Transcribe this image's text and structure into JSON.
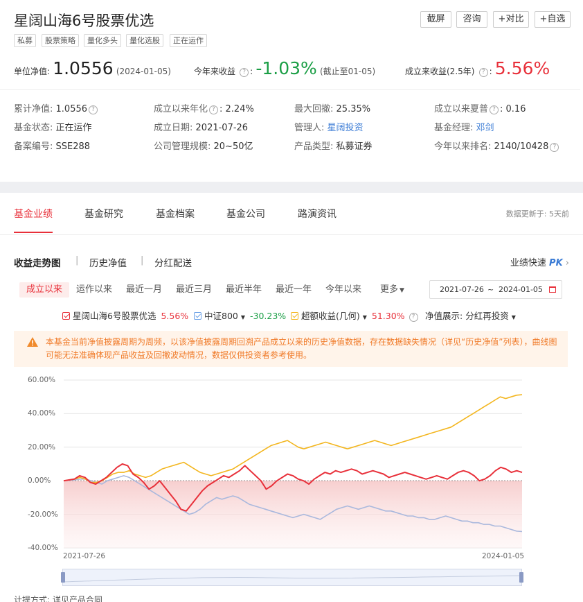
{
  "header": {
    "title": "星阔山海6号股票优选",
    "tags": [
      "私募",
      "股票策略",
      "量化多头",
      "量化选股",
      "正在运作"
    ],
    "buttons": [
      "截屏",
      "咨询",
      "+对比",
      "+自选"
    ]
  },
  "nav_summary": {
    "unit_nav_label": "单位净值:",
    "unit_nav_value": "1.0556",
    "unit_nav_date": "(2024-01-05)",
    "ytd_label": "今年来收益",
    "ytd_value": "-1.03%",
    "ytd_note": "(截止至01-05)",
    "since_label": "成立来收益(2.5年)",
    "since_value": "5.56%"
  },
  "info": {
    "r1": [
      {
        "k": "累计净值:",
        "v": "1.0556"
      },
      {
        "k": "成立以来年化",
        "v": "2.24%"
      },
      {
        "k": "最大回撤:",
        "v": "25.35%"
      },
      {
        "k": "成立以来夏普",
        "v": "0.16"
      }
    ],
    "r2": [
      {
        "k": "基金状态:",
        "v": "正在运作"
      },
      {
        "k": "成立日期:",
        "v": "2021-07-26"
      },
      {
        "k": "管理人:",
        "v": "星阔投资"
      },
      {
        "k": "基金经理:",
        "v": "邓剑"
      }
    ],
    "r3": [
      {
        "k": "备案编号:",
        "v": "SSE288"
      },
      {
        "k": "公司管理规模:",
        "v": "20~50亿"
      },
      {
        "k": "产品类型:",
        "v": "私募证券"
      },
      {
        "k": "今年以来排名:",
        "v": "2140/10428"
      }
    ]
  },
  "tabs": [
    "基金业绩",
    "基金研究",
    "基金档案",
    "基金公司",
    "路演资讯"
  ],
  "update_note": "数据更新于: 5天前",
  "subtabs": [
    "收益走势图",
    "历史净值",
    "分红配送"
  ],
  "pk_label": "业绩快速",
  "pk_badge": "PK",
  "ranges": [
    "成立以来",
    "运作以来",
    "最近一月",
    "最近三月",
    "最近半年",
    "最近一年",
    "今年以来",
    "更多"
  ],
  "date_from": "2021-07-26",
  "date_sep": "~",
  "date_to": "2024-01-05",
  "legend": {
    "fund_name": "星阔山海6号股票优选",
    "fund_value": "5.56%",
    "index_name": "中证800",
    "index_value": "-30.23%",
    "excess_name": "超额收益(几何)",
    "excess_value": "51.30%",
    "display_label": "净值展示:",
    "display_value": "分红再投资"
  },
  "notice": "本基金当前净值披露周期为周频，以该净值披露周期回溯产品成立以来的历史净值数据，存在数据缺失情况（详见“历史净值”列表），曲线图可能无法准确体现产品收益及回撤波动情况，数据仅供投资者参考使用。",
  "footer_label": "计提方式: 详见产品合同",
  "colors": {
    "fund": "#e8303a",
    "index": "#a9b8dd",
    "excess": "#f3b61f",
    "accent": "#e8303a"
  },
  "chart_data": {
    "type": "line",
    "x_start": "2021-07-26",
    "x_end": "2024-01-05",
    "ylim": [
      -40,
      60
    ],
    "yticks": [
      "60.00%",
      "40.00%",
      "20.00%",
      "0.00%",
      "-20.00%",
      "-40.00%"
    ],
    "series": [
      {
        "name": "星阔山海6号股票优选",
        "values": [
          0,
          0.5,
          1,
          3,
          2,
          -1,
          -2,
          0,
          2,
          5,
          8,
          10,
          9,
          4,
          2,
          -1,
          -5,
          -3,
          0,
          -4,
          -8,
          -12,
          -17,
          -18,
          -14,
          -10,
          -6,
          -3,
          -1,
          1,
          3,
          2,
          4,
          6,
          9,
          6,
          3,
          0,
          -5,
          -3,
          0,
          2,
          4,
          3,
          1,
          0,
          -2,
          1,
          3,
          5,
          4,
          6,
          5,
          6,
          7,
          6,
          4,
          5,
          6,
          5,
          4,
          2,
          3,
          4,
          5,
          4,
          3,
          2,
          1,
          2,
          3,
          2,
          1,
          3,
          5,
          6,
          5,
          3,
          0,
          1,
          3,
          6,
          8,
          7,
          5,
          6,
          5
        ]
      },
      {
        "name": "中证800",
        "values": [
          0,
          0.3,
          0.5,
          1,
          1,
          0,
          -1,
          -2,
          0,
          1,
          2,
          3,
          2,
          0,
          -2,
          -4,
          -6,
          -8,
          -10,
          -12,
          -14,
          -16,
          -18,
          -20,
          -19,
          -17,
          -14,
          -12,
          -10,
          -11,
          -10,
          -9,
          -10,
          -12,
          -14,
          -15,
          -16,
          -17,
          -18,
          -19,
          -20,
          -21,
          -22,
          -21,
          -20,
          -21,
          -22,
          -23,
          -21,
          -19,
          -17,
          -16,
          -15,
          -16,
          -17,
          -16,
          -15,
          -16,
          -17,
          -18,
          -18,
          -19,
          -20,
          -21,
          -21,
          -22,
          -22,
          -23,
          -23,
          -22,
          -21,
          -22,
          -23,
          -24,
          -24,
          -25,
          -25,
          -26,
          -26,
          -27,
          -27,
          -28,
          -29,
          -30,
          -30.23
        ]
      },
      {
        "name": "超额收益(几何)",
        "values": [
          0,
          0.5,
          1,
          2,
          1,
          -1,
          -1,
          0,
          2,
          4,
          5,
          5,
          6,
          4,
          3,
          2,
          3,
          5,
          7,
          8,
          9,
          10,
          11,
          9,
          7,
          5,
          4,
          3,
          4,
          5,
          6,
          7,
          9,
          11,
          13,
          15,
          17,
          19,
          21,
          22,
          23,
          24,
          22,
          20,
          19,
          20,
          21,
          22,
          23,
          22,
          21,
          20,
          19,
          20,
          21,
          22,
          23,
          24,
          23,
          22,
          21,
          22,
          23,
          24,
          25,
          26,
          27,
          28,
          29,
          30,
          31,
          32,
          34,
          36,
          38,
          40,
          42,
          44,
          46,
          48,
          50,
          49,
          50,
          51,
          51.3
        ]
      }
    ]
  }
}
